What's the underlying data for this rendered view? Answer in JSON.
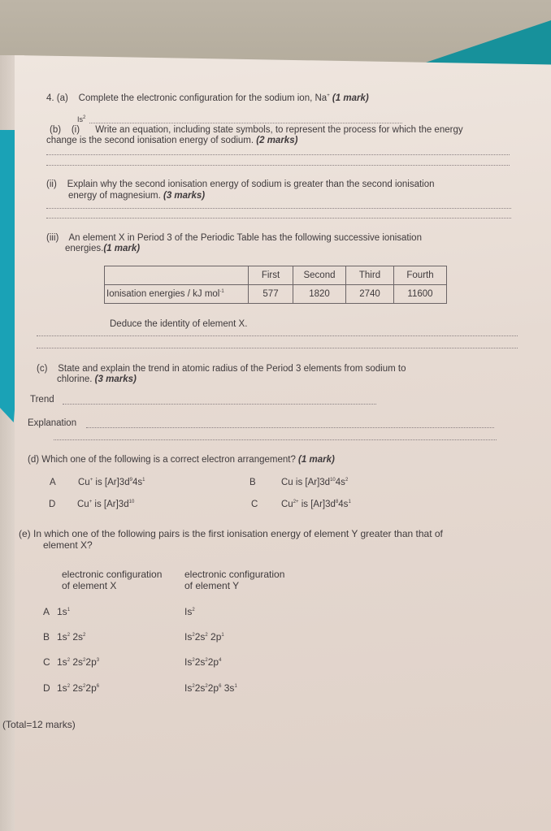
{
  "question_number": "4.",
  "part_a": {
    "label": "(a)",
    "text": "Complete the electronic configuration for the sodium ion, Na",
    "ion_charge": "+",
    "marks": "(1 mark)",
    "answer_prefix": "Is",
    "answer_prefix_sup": "2"
  },
  "part_b": {
    "label": "(b)",
    "i": {
      "label": "(i)",
      "line1": "Write an equation, including state symbols, to represent the process for which the energy",
      "line2": "change is the second ionisation energy of sodium.",
      "marks": "(2 marks)"
    },
    "ii": {
      "label": "(ii)",
      "line1": "Explain why the second ionisation energy of sodium is greater than the second ionisation",
      "line2": "energy of magnesium.",
      "marks": "(3 marks)"
    },
    "iii": {
      "label": "(iii)",
      "line1": "An element X in Period 3 of the Periodic Table has the following successive ionisation",
      "line2": "energies.",
      "marks": "(1 mark)",
      "table": {
        "headers": [
          "",
          "First",
          "Second",
          "Third",
          "Fourth"
        ],
        "row_label": "Ionisation energies / kJ mol",
        "row_label_sup": "-1",
        "values": [
          "577",
          "1820",
          "2740",
          "11600"
        ]
      },
      "deduce": "Deduce the identity of element X."
    }
  },
  "part_c": {
    "label": "(c)",
    "line1": "State and explain the trend in atomic radius of the Period 3 elements from sodium to",
    "line2": "chlorine.",
    "marks": "(3 marks)",
    "trend_label": "Trend",
    "explanation_label": "Explanation"
  },
  "part_d": {
    "label": "(d)",
    "text": "Which one of the following is a correct electron arrangement?",
    "marks": "(1 mark)",
    "options": [
      {
        "letter": "A",
        "species": "Cu",
        "charge": "+",
        "text": " is [Ar]3d",
        "sup1": "9",
        "text2": "4s",
        "sup2": "1"
      },
      {
        "letter": "B",
        "species": "Cu",
        "charge": "",
        "text": " is [Ar]3d",
        "sup1": "10",
        "text2": "4s",
        "sup2": "2"
      },
      {
        "letter": "D",
        "species": "Cu",
        "charge": "+",
        "text": " is [Ar]3d",
        "sup1": "10",
        "text2": "",
        "sup2": ""
      },
      {
        "letter": "C",
        "species": "Cu",
        "charge": "2+",
        "text": " is [Ar]3d",
        "sup1": "8",
        "text2": "4s",
        "sup2": "1"
      }
    ]
  },
  "part_e": {
    "label": "(e)",
    "line1": "In which one of the following pairs is the first ionisation energy of element Y greater than that of",
    "line2": "element X?",
    "col_x_line1": "electronic configuration",
    "col_x_line2": "of element X",
    "col_y_line1": "electronic configuration",
    "col_y_line2": "of element Y",
    "options": [
      {
        "letter": "A",
        "x": [
          [
            "1s",
            "1"
          ]
        ],
        "y": [
          [
            "Is",
            "2"
          ]
        ]
      },
      {
        "letter": "B",
        "x": [
          [
            "1s",
            "2"
          ],
          [
            " 2s",
            "2"
          ]
        ],
        "y": [
          [
            "Is",
            "2"
          ],
          [
            "2s",
            "2"
          ],
          [
            " 2p",
            "1"
          ]
        ]
      },
      {
        "letter": "C",
        "x": [
          [
            "1s",
            "2"
          ],
          [
            " 2s",
            "2"
          ],
          [
            "2p",
            "3"
          ]
        ],
        "y": [
          [
            "Is",
            "2"
          ],
          [
            "2s",
            "2"
          ],
          [
            "2p",
            "4"
          ]
        ]
      },
      {
        "letter": "D",
        "x": [
          [
            "1s",
            "2"
          ],
          [
            " 2s",
            "2"
          ],
          [
            "2p",
            "6"
          ]
        ],
        "y": [
          [
            "Is",
            "2"
          ],
          [
            "2s",
            "2"
          ],
          [
            "2p",
            "6"
          ],
          [
            " 3s",
            "1"
          ]
        ]
      }
    ]
  },
  "total": "(Total=12 marks)"
}
